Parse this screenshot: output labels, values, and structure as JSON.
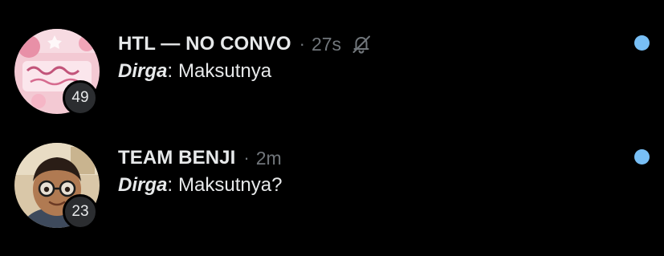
{
  "colors": {
    "background": "#000000",
    "primary_text": "#e7e9ea",
    "secondary_text": "#71767b",
    "unread_dot": "#78bff5",
    "badge_bg": "#2b2d30"
  },
  "conversations": [
    {
      "name": "HTL — NO CONVO",
      "separator": "·",
      "time": "27s",
      "muted": true,
      "mute_icon": "bell-off-icon",
      "sender": "Dirga",
      "colon": ":",
      "message": "Maksutnya",
      "member_count": "49",
      "unread": true
    },
    {
      "name": "TEAM BENJI",
      "separator": "·",
      "time": "2m",
      "muted": false,
      "sender": "Dirga",
      "colon": ":",
      "message": "Maksutnya?",
      "member_count": "23",
      "unread": true
    }
  ]
}
